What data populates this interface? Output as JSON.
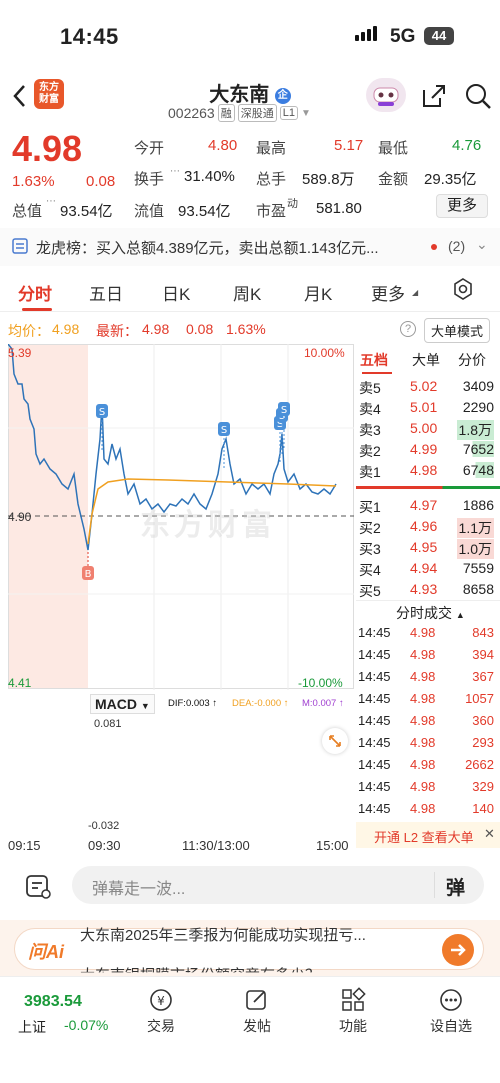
{
  "status_bar": {
    "time": "14:45",
    "network": "5G",
    "battery": "44"
  },
  "header": {
    "logo_text_1": "东方",
    "logo_text_2": "财富",
    "title": "大东南",
    "title_badge": "企",
    "code": "002263",
    "tag_rong": "融",
    "tag_sgt": "深股通",
    "tag_level": "L1"
  },
  "quote": {
    "price": "4.98",
    "change_pct": "1.63%",
    "change_amt": "0.08",
    "open_label": "今开",
    "open": "4.80",
    "high_label": "最高",
    "high": "5.17",
    "low_label": "最低",
    "low": "4.76",
    "turnover_label": "换手",
    "turnover": "31.40%",
    "volume_label": "总手",
    "volume": "589.8万",
    "amount_label": "金额",
    "amount": "29.35亿",
    "mktcap_label": "总值",
    "mktcap": "93.54亿",
    "float_label": "流值",
    "float": "93.54亿",
    "pe_label": "市盈",
    "pe_sup": "动",
    "pe": "581.80",
    "more_label": "更多"
  },
  "lhb": {
    "text": "龙虎榜：买入总额4.389亿元，卖出总额1.143亿元...",
    "count": "(2)"
  },
  "tabs": [
    "分时",
    "五日",
    "日K",
    "周K",
    "月K",
    "更多"
  ],
  "avg_line": {
    "avg_label": "均价：",
    "avg": "4.98",
    "latest_label": "最新：",
    "latest": "4.98",
    "latest_chg": "0.08",
    "latest_pct": "1.63%",
    "bigorder_label": "大单模式"
  },
  "chart": {
    "y_top": "5.39",
    "y_mid": "4.90",
    "y_bot": "4.41",
    "pct_top": "10.00%",
    "pct_bot": "-10.00%",
    "watermark": "东方财富",
    "macd_label": "MACD",
    "dif": "DIF:0.003 ↑",
    "dea": "DEA:-0.000 ↑",
    "m": "M:0.007 ↑",
    "macd_top": "0.081",
    "macd_bot": "-0.032",
    "time_ticks": [
      "09:15",
      "09:30",
      "11:30/13:00",
      "15:00"
    ],
    "marker_s": "S",
    "marker_b": "B"
  },
  "orderbook": {
    "header": [
      "五档",
      "大单",
      "分价"
    ],
    "asks": [
      {
        "label": "卖5",
        "price": "5.02",
        "vol": "3409"
      },
      {
        "label": "卖4",
        "price": "5.01",
        "vol": "2290"
      },
      {
        "label": "卖3",
        "price": "5.00",
        "vol": "1.8万"
      },
      {
        "label": "卖2",
        "price": "4.99",
        "vol": "7652"
      },
      {
        "label": "卖1",
        "price": "4.98",
        "vol": "6748"
      }
    ],
    "bids": [
      {
        "label": "买1",
        "price": "4.97",
        "vol": "1886"
      },
      {
        "label": "买2",
        "price": "4.96",
        "vol": "1.1万"
      },
      {
        "label": "买3",
        "price": "4.95",
        "vol": "1.0万"
      },
      {
        "label": "买4",
        "price": "4.94",
        "vol": "7559"
      },
      {
        "label": "买5",
        "price": "4.93",
        "vol": "8658"
      }
    ],
    "trades_title": "分时成交",
    "trades": [
      {
        "time": "14:45",
        "price": "4.98",
        "vol": "843"
      },
      {
        "time": "14:45",
        "price": "4.98",
        "vol": "394"
      },
      {
        "time": "14:45",
        "price": "4.98",
        "vol": "367"
      },
      {
        "time": "14:45",
        "price": "4.98",
        "vol": "1057"
      },
      {
        "time": "14:45",
        "price": "4.98",
        "vol": "360"
      },
      {
        "time": "14:45",
        "price": "4.98",
        "vol": "293"
      },
      {
        "time": "14:45",
        "price": "4.98",
        "vol": "2662"
      },
      {
        "time": "14:45",
        "price": "4.98",
        "vol": "329"
      },
      {
        "time": "14:45",
        "price": "4.98",
        "vol": "140"
      }
    ],
    "l2_label": "开通 L2 查看大单"
  },
  "input": {
    "placeholder": "弹幕走一波...",
    "danmu_btn": "弹"
  },
  "ai": {
    "label": "问Ai",
    "news_1": "大东南2025年三季报为何能成功实现扭亏...",
    "news_2": "大东南银桐膜市场份额究竟有多少？"
  },
  "nav": {
    "index_value": "3983.54",
    "index_name": "上证",
    "index_chg": "-0.07%",
    "items": [
      "交易",
      "发帖",
      "功能",
      "设自选"
    ]
  },
  "colors": {
    "up": "#e23a2a",
    "down": "#1a9a3a",
    "price_line": "#2e73b8",
    "avg_line": "#f0a020"
  }
}
